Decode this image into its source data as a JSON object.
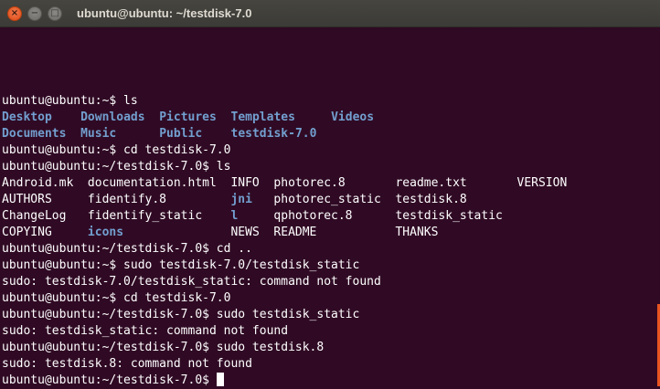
{
  "window": {
    "title": "ubuntu@ubuntu: ~/testdisk-7.0",
    "close_glyph": "×",
    "minimize_glyph": "−",
    "maximize_glyph": "□"
  },
  "colors": {
    "background": "#300a24",
    "text": "#ffffff",
    "directory": "#729fcf",
    "titlebar": "#3c3b37",
    "close_button": "#df4a16",
    "scroll_indicator": "#e95420"
  },
  "terminal": {
    "lines": [
      [
        {
          "t": "ubuntu@ubuntu:~$ ls"
        }
      ],
      [
        {
          "t": "Desktop",
          "dir": true
        },
        {
          "t": "    "
        },
        {
          "t": "Downloads",
          "dir": true
        },
        {
          "t": "  "
        },
        {
          "t": "Pictures",
          "dir": true
        },
        {
          "t": "  "
        },
        {
          "t": "Templates",
          "dir": true
        },
        {
          "t": "     "
        },
        {
          "t": "Videos",
          "dir": true
        }
      ],
      [
        {
          "t": "Documents",
          "dir": true
        },
        {
          "t": "  "
        },
        {
          "t": "Music",
          "dir": true
        },
        {
          "t": "      "
        },
        {
          "t": "Public",
          "dir": true
        },
        {
          "t": "    "
        },
        {
          "t": "testdisk-7.0",
          "dir": true
        }
      ],
      [
        {
          "t": "ubuntu@ubuntu:~$ cd testdisk-7.0"
        }
      ],
      [
        {
          "t": "ubuntu@ubuntu:~/testdisk-7.0$ ls"
        }
      ],
      [
        {
          "t": "Android.mk  documentation.html  INFO  photorec.8       readme.txt       VERSION"
        }
      ],
      [
        {
          "t": "AUTHORS     fidentify.8         "
        },
        {
          "t": "jni",
          "dir": true
        },
        {
          "t": "   photorec_static  testdisk.8"
        }
      ],
      [
        {
          "t": "ChangeLog   fidentify_static    "
        },
        {
          "t": "l",
          "dir": true
        },
        {
          "t": "     qphotorec.8      testdisk_static"
        }
      ],
      [
        {
          "t": "COPYING     "
        },
        {
          "t": "icons",
          "dir": true
        },
        {
          "t": "               NEWS  README           THANKS"
        }
      ],
      [
        {
          "t": "ubuntu@ubuntu:~/testdisk-7.0$ cd .."
        }
      ],
      [
        {
          "t": "ubuntu@ubuntu:~$ sudo testdisk-7.0/testdisk_static"
        }
      ],
      [
        {
          "t": "sudo: testdisk-7.0/testdisk_static: command not found"
        }
      ],
      [
        {
          "t": "ubuntu@ubuntu:~$ cd testdisk-7.0"
        }
      ],
      [
        {
          "t": "ubuntu@ubuntu:~/testdisk-7.0$ sudo testdisk_static"
        }
      ],
      [
        {
          "t": "sudo: testdisk_static: command not found"
        }
      ],
      [
        {
          "t": "ubuntu@ubuntu:~/testdisk-7.0$ sudo testdisk.8"
        }
      ],
      [
        {
          "t": "sudo: testdisk.8: command not found"
        }
      ],
      [
        {
          "t": "ubuntu@ubuntu:~/testdisk-7.0$ "
        }
      ]
    ]
  }
}
